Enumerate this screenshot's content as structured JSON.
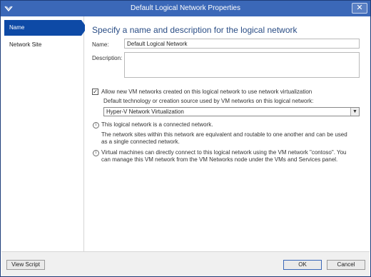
{
  "window": {
    "title": "Default Logical Network Properties",
    "close_glyph": "✕",
    "system_icon": "vmm-app-icon"
  },
  "sidebar": {
    "items": [
      {
        "label": "Name",
        "active": true
      },
      {
        "label": "Network Site",
        "active": false
      }
    ]
  },
  "main": {
    "heading": "Specify a name and description for the logical network",
    "name_label": "Name:",
    "name_value": "Default Logical Network",
    "description_label": "Description:",
    "description_value": "",
    "allow_vm_networks": {
      "checked": true,
      "check_glyph": "✓",
      "label": "Allow new VM networks created on this logical network to use network virtualization"
    },
    "default_technology_label": "Default technology or creation source used by VM networks on this logical network:",
    "default_technology_value": "Hyper-V Network Virtualization",
    "dropdown_glyph": "▼",
    "info1": {
      "icon_glyph": "i",
      "title": "This logical network is a connected network.",
      "text": "The network sites within this network are equivalent and routable to one another and can be used as a single connected network."
    },
    "info2": {
      "icon_glyph": "i",
      "text": "Virtual machines can directly connect to this logical network using the VM network \"contoso\". You can manage this VM network from the VM Networks node under the VMs and Services panel."
    }
  },
  "footer": {
    "view_script": "View Script",
    "ok": "OK",
    "cancel": "Cancel"
  },
  "colors": {
    "titlebar": "#3b68b8",
    "active_nav": "#0e4aa6",
    "heading": "#2a4d85"
  }
}
